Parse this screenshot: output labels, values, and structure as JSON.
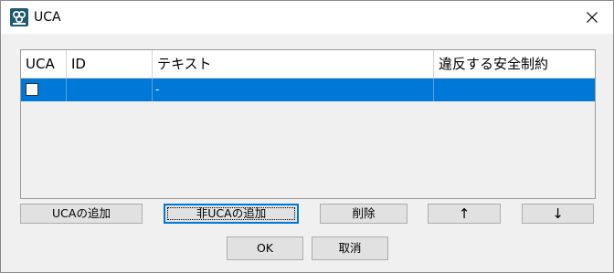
{
  "window": {
    "title": "UCA"
  },
  "icons": {
    "app": "app-logo-icon",
    "close": "close-icon"
  },
  "table": {
    "columns": [
      "UCA",
      "ID",
      "テキスト",
      "違反する安全制約"
    ],
    "rows": [
      {
        "uca_checked": false,
        "id": "",
        "text": "-",
        "violated_constraint": ""
      }
    ],
    "selected_row_color": "#0078d7"
  },
  "buttons": {
    "add_uca": "UCAの追加",
    "add_non_uca": "非UCAの追加",
    "delete": "削除",
    "up": "↑",
    "down": "↓",
    "ok": "OK",
    "cancel": "取消"
  }
}
